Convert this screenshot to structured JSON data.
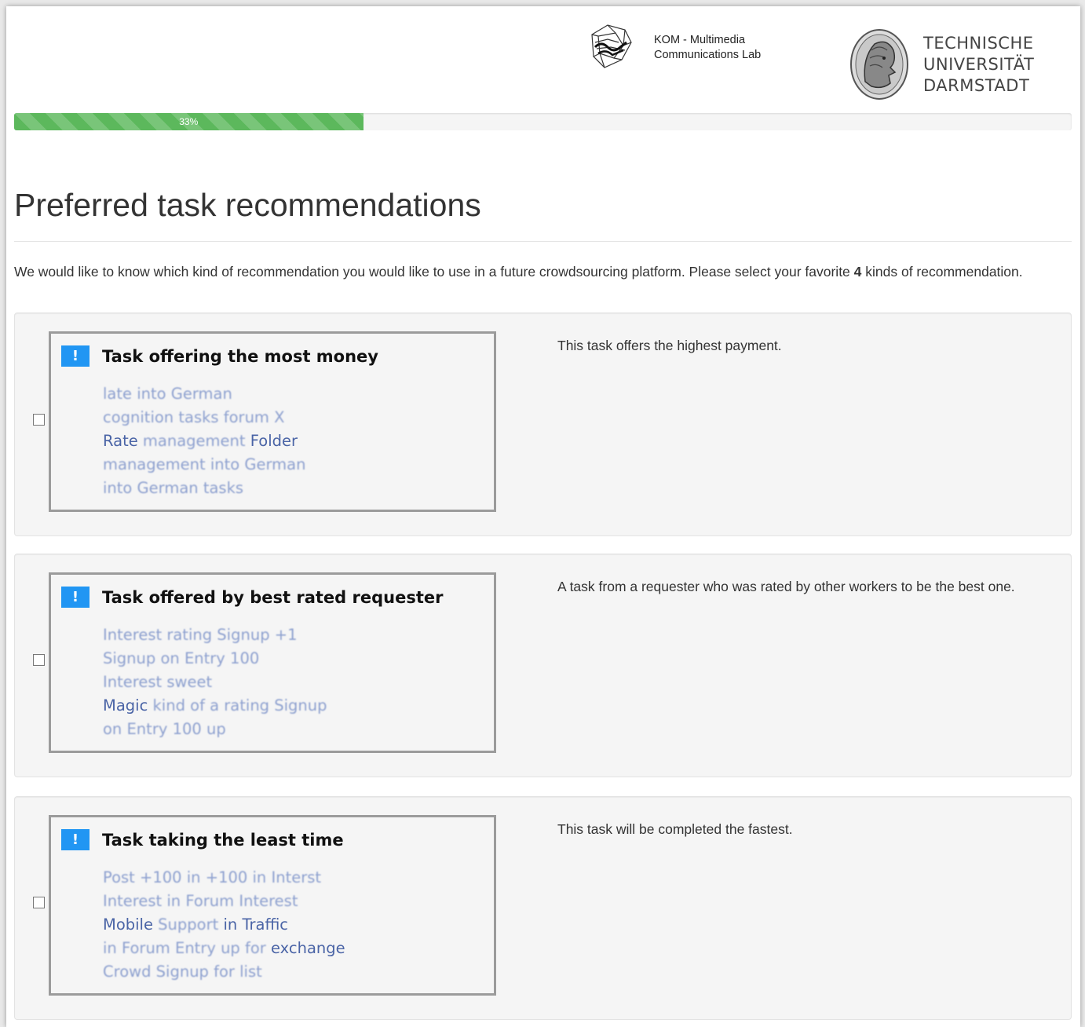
{
  "header": {
    "kom_line1": "KOM  -  Multimedia",
    "kom_line2": "Communications Lab",
    "tu_line1": "TECHNISCHE",
    "tu_line2": "UNIVERSITÄT",
    "tu_line3": "DARMSTADT"
  },
  "progress": {
    "value": 33,
    "label": "33%",
    "color": "#5cb85c"
  },
  "page_title": "Preferred task recommendations",
  "intro": {
    "before": "We would like to know which kind of recommendation you would like to use in a future crowdsourcing platform. Please select your favorite ",
    "count": "4",
    "after": " kinds of recommendation."
  },
  "options": [
    {
      "title": "Task offering the most money",
      "description": "This task offers the highest payment.",
      "lines": [
        {
          "clear": "",
          "blur": "late into German"
        },
        {
          "clear": "",
          "blur": "cognition tasks forum X"
        },
        {
          "clear": "Rate ",
          "blur": "management",
          "tail": " Folder"
        },
        {
          "clear": "",
          "blur": "management into German"
        },
        {
          "clear": "",
          "blur": "into German  tasks"
        }
      ]
    },
    {
      "title": "Task offered by best rated requester",
      "description": "A task from a requester who was rated by other workers to be the best one.",
      "lines": [
        {
          "clear": "",
          "blur": "Interest rating Signup +1"
        },
        {
          "clear": "",
          "blur": "Signup on Entry 100"
        },
        {
          "clear": "",
          "blur": "Interest sweet"
        },
        {
          "clear": "Magic ",
          "blur": "kind of a rating Signup"
        },
        {
          "clear": "",
          "blur": "on Entry 100 up"
        }
      ]
    },
    {
      "title": "Task taking the least time",
      "description": "This task will be completed the fastest.",
      "lines": [
        {
          "clear": "",
          "blur": "Post +100 in +100 in Interst"
        },
        {
          "clear": "",
          "blur": "Interest in Forum Interest"
        },
        {
          "clear": "Mobile ",
          "blur": "Support",
          "tail": " in Traffic"
        },
        {
          "clear": "",
          "blur": "in Forum Entry up for",
          "tail": " exchange"
        },
        {
          "clear": "",
          "blur": "Crowd Signup for list"
        }
      ]
    }
  ]
}
